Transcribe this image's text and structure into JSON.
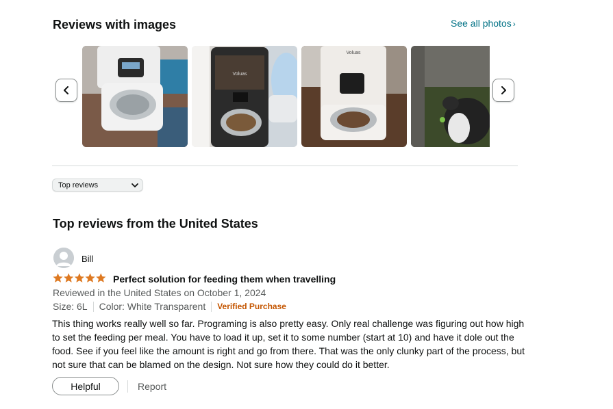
{
  "images_section": {
    "title": "Reviews with images",
    "see_all": "See all photos",
    "chevron_right": "›",
    "thumbnails": [
      {
        "label": "review-image-1"
      },
      {
        "label": "review-image-2",
        "brand_text": "Voluas"
      },
      {
        "label": "review-image-3",
        "brand_text": "Voluas"
      },
      {
        "label": "review-image-4"
      }
    ]
  },
  "sort": {
    "selected": "Top reviews"
  },
  "reviews_heading": "Top reviews from the United States",
  "review": {
    "author": "Bill",
    "rating": 5,
    "rating_max": 5,
    "title": "Perfect solution for feeding them when travelling",
    "date_line": "Reviewed in the United States on October 1, 2024",
    "size": "Size: 6L",
    "color": "Color: White Transparent",
    "verified": "Verified Purchase",
    "body": "This thing works really well so far. Programing is also pretty easy. Only real challenge was figuring out how high to set the feeding per meal. You have to load it up, set it to some number (start at 10) and have it dole out the food. See if you feel like the amount is right and go from there. That was the only clunky part of the process, but not sure that can be blamed on the design. Not sure how they could do it better.",
    "helpful_label": "Helpful",
    "report_label": "Report"
  },
  "colors": {
    "star": "#de7921",
    "link": "#007185",
    "verified": "#c45500",
    "muted": "#565959"
  }
}
